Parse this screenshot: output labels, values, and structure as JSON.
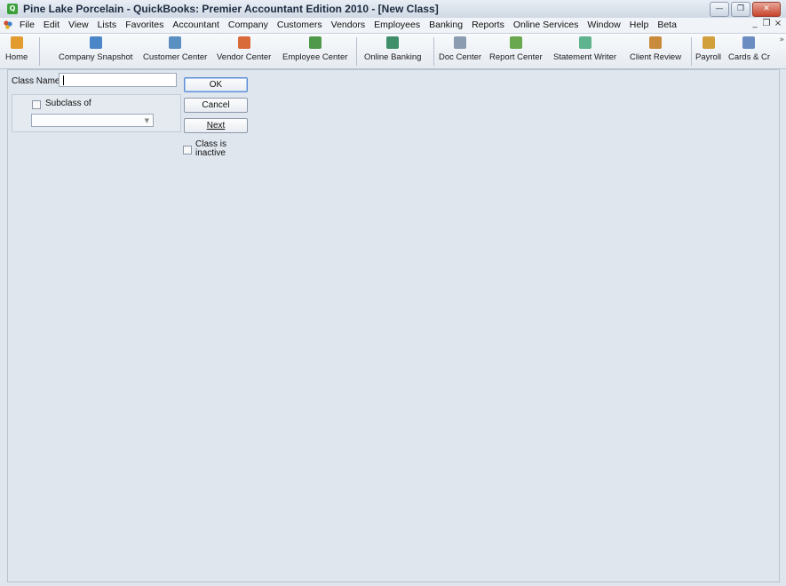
{
  "window": {
    "title": "Pine Lake Porcelain  - QuickBooks: Premier Accountant Edition 2010 - [New Class]",
    "controls": [
      "minimize",
      "maximize",
      "close"
    ]
  },
  "menubar": {
    "items": [
      "File",
      "Edit",
      "View",
      "Lists",
      "Favorites",
      "Accountant",
      "Company",
      "Customers",
      "Vendors",
      "Employees",
      "Banking",
      "Reports",
      "Online Services",
      "Window",
      "Help",
      "Beta"
    ],
    "mdi_controls": [
      "_",
      "·",
      "x"
    ]
  },
  "toolbar": {
    "items": [
      {
        "label": "Home",
        "icon": "home-icon",
        "color": "#e39b2f"
      },
      {
        "label": "Company Snapshot",
        "icon": "company-snapshot-icon",
        "color": "#4a86c8"
      },
      {
        "label": "Customer Center",
        "icon": "customer-center-icon",
        "color": "#5a8fc2"
      },
      {
        "label": "Vendor Center",
        "icon": "vendor-center-icon",
        "color": "#d96b3a"
      },
      {
        "label": "Employee Center",
        "icon": "employee-center-icon",
        "color": "#4f9a4a"
      },
      {
        "label": "Online Banking",
        "icon": "online-banking-icon",
        "color": "#3f8f6b"
      },
      {
        "label": "Doc Center",
        "icon": "doc-center-icon",
        "color": "#8b9bb0"
      },
      {
        "label": "Report Center",
        "icon": "report-center-icon",
        "color": "#6aa84f"
      },
      {
        "label": "Statement Writer",
        "icon": "statement-writer-icon",
        "color": "#5fb38f"
      },
      {
        "label": "Client Review",
        "icon": "client-review-icon",
        "color": "#c98a3b"
      },
      {
        "label": "Payroll",
        "icon": "payroll-icon",
        "color": "#d2a03b"
      },
      {
        "label": "Cards & Cr",
        "icon": "cards-credit-icon",
        "color": "#6b8cc0"
      }
    ],
    "overflow": "»"
  },
  "form": {
    "class_name_label": "Class Name",
    "class_name_value": "",
    "subclass_label": "Subclass of",
    "subclass_checked": false,
    "subclass_select_value": "",
    "ok_label": "OK",
    "cancel_label": "Cancel",
    "next_label": "Next",
    "inactive_label_line1": "Class is",
    "inactive_label_line2": "inactive",
    "inactive_checked": false
  }
}
